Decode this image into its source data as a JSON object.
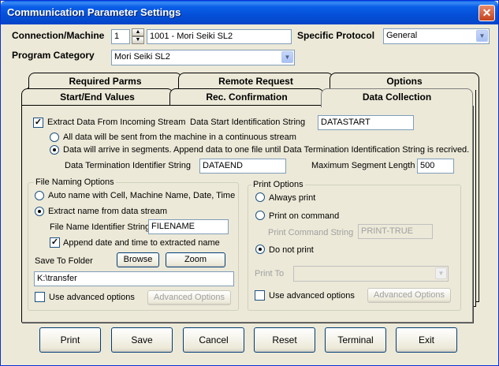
{
  "window": {
    "title": "Communication Parameter Settings",
    "close": "✕"
  },
  "header": {
    "connection_label": "Connection/Machine",
    "connection_number": "1",
    "connection_name": "1001 - Mori Seiki SL2",
    "protocol_label": "Specific Protocol",
    "protocol_value": "General",
    "program_category_label": "Program Category",
    "program_category_value": "Mori Seiki SL2"
  },
  "tabs": {
    "row_back": [
      "Required Parms",
      "Remote Request",
      "Options"
    ],
    "row_front": [
      "Start/End Values",
      "Rec. Confirmation",
      "Data Collection"
    ],
    "active": "Data Collection"
  },
  "data_collection": {
    "extract_label": "Extract Data From Incoming Stream",
    "extract_checked": true,
    "start_id_label": "Data Start Identification String",
    "start_id_value": "DATASTART",
    "radio_continuous": "All data will be sent from the machine in a continuous stream",
    "radio_segments": "Data will arrive in segments.  Append data to one file until Data Termination Identification String is recrived.",
    "term_id_label": "Data Termination Identifier String",
    "term_id_value": "DATAEND",
    "max_seg_label": "Maximum Segment Length",
    "max_seg_value": "500"
  },
  "file_naming": {
    "title": "File Naming Options",
    "radio_auto": "Auto name with Cell, Machine Name, Date, Time",
    "radio_extract": "Extract name from data stream",
    "identifier_label": "File Name Identifier String",
    "identifier_value": "FILENAME",
    "append_label": "Append date and time to extracted name",
    "append_checked": true,
    "save_folder_label": "Save To Folder",
    "browse": "Browse",
    "zoom": "Zoom",
    "folder_value": "K:\\transfer",
    "advanced_label": "Use advanced options",
    "advanced_button": "Advanced Options"
  },
  "print_options": {
    "title": "Print Options",
    "radio_always": "Always print",
    "radio_command": "Print on command",
    "command_label": "Print Command String",
    "command_value": "PRINT-TRUE",
    "radio_donot": "Do not print",
    "print_to_label": "Print To",
    "print_to_value": "",
    "advanced_label": "Use advanced options",
    "advanced_button": "Advanced Options"
  },
  "footer": {
    "print": "Print",
    "save": "Save",
    "cancel": "Cancel",
    "reset": "Reset",
    "terminal": "Terminal",
    "exit": "Exit"
  }
}
